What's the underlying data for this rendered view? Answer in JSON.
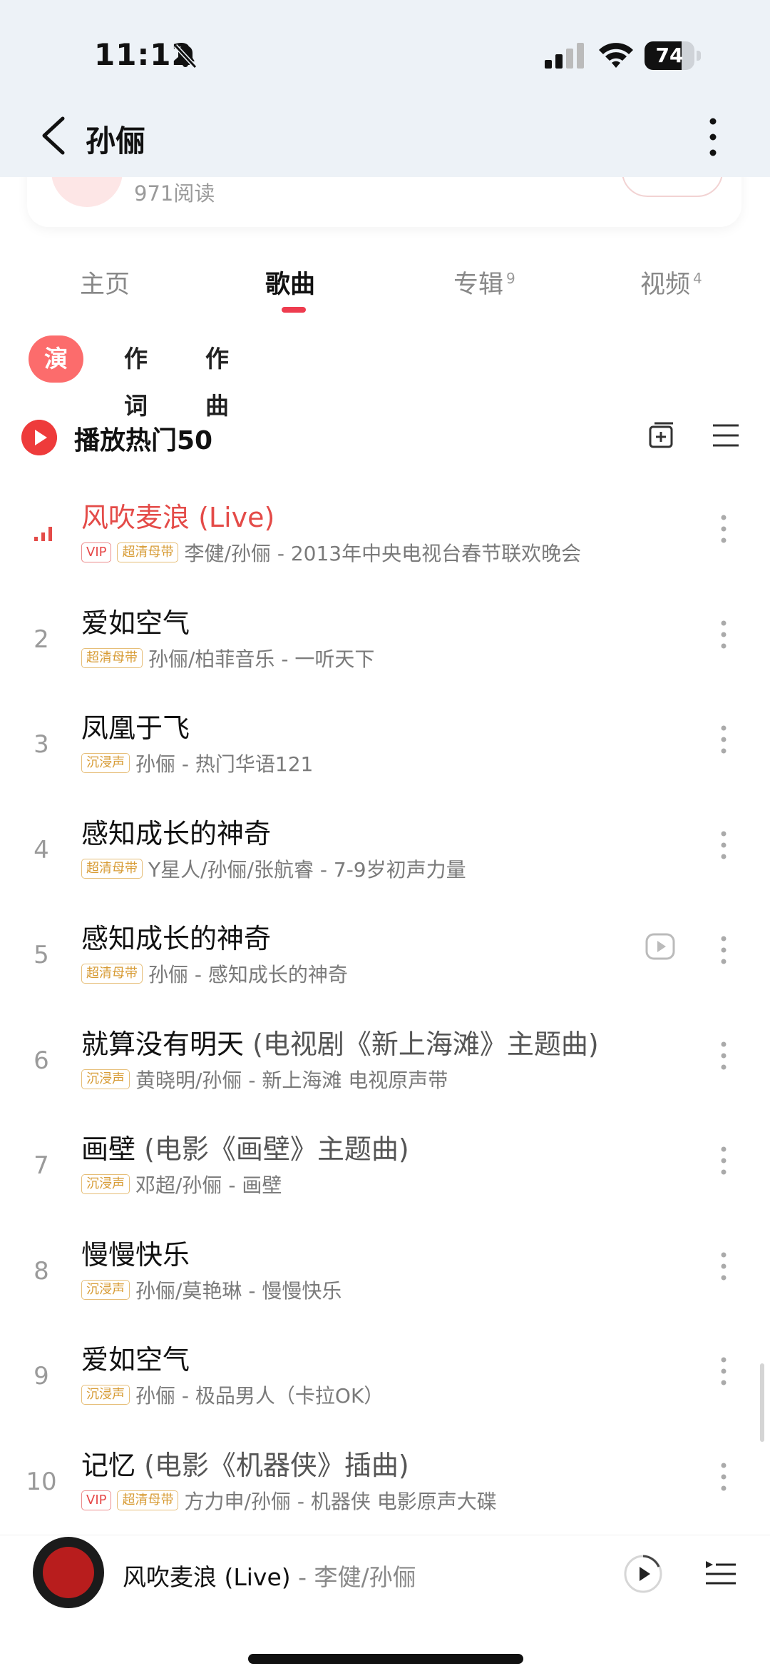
{
  "status_bar": {
    "time": "11:12",
    "battery": "74",
    "battery_level": 0.74
  },
  "header": {
    "title": "孙俪"
  },
  "profile_card": {
    "reads": "971阅读"
  },
  "tabs": [
    {
      "label": "主页",
      "count": ""
    },
    {
      "label": "歌曲",
      "count": ""
    },
    {
      "label": "专辑",
      "count": "9"
    },
    {
      "label": "视频",
      "count": "4"
    }
  ],
  "filters": [
    "演唱",
    "作词",
    "作曲"
  ],
  "play_all": {
    "label": "播放热门50"
  },
  "songs": [
    {
      "index": "",
      "title": "风吹麦浪",
      "suffix": " (Live)",
      "badges": [
        "VIP",
        "超清母带"
      ],
      "meta": "李健/孙俪 - 2013年中央电视台春节联欢晚会"
    },
    {
      "index": "2",
      "title": "爱如空气",
      "suffix": "",
      "badges": [
        "超清母带"
      ],
      "meta": "孙俪/柏菲音乐 - 一听天下"
    },
    {
      "index": "3",
      "title": "凤凰于飞",
      "suffix": "",
      "badges": [
        "沉浸声"
      ],
      "meta": "孙俪 - 热门华语121"
    },
    {
      "index": "4",
      "title": "感知成长的神奇",
      "suffix": "",
      "badges": [
        "超清母带"
      ],
      "meta": "Y星人/孙俪/张航睿 - 7-9岁初声力量"
    },
    {
      "index": "5",
      "title": "感知成长的神奇",
      "suffix": "",
      "badges": [
        "超清母带"
      ],
      "meta": "孙俪 - 感知成长的神奇"
    },
    {
      "index": "6",
      "title": "就算没有明天",
      "suffix": " (电视剧《新上海滩》主题曲)",
      "badges": [
        "沉浸声"
      ],
      "meta": "黄晓明/孙俪 - 新上海滩 电视原声带"
    },
    {
      "index": "7",
      "title": "画壁",
      "suffix": " (电影《画壁》主题曲)",
      "badges": [
        "沉浸声"
      ],
      "meta": "邓超/孙俪 - 画壁"
    },
    {
      "index": "8",
      "title": "慢慢快乐",
      "suffix": "",
      "badges": [
        "沉浸声"
      ],
      "meta": "孙俪/莫艳琳 - 慢慢快乐"
    },
    {
      "index": "9",
      "title": "爱如空气",
      "suffix": "",
      "badges": [
        "沉浸声"
      ],
      "meta": "孙俪 - 极品男人（卡拉OK）"
    },
    {
      "index": "10",
      "title": "记忆",
      "suffix": " (电影《机器侠》插曲)",
      "badges": [
        "VIP",
        "超清母带"
      ],
      "meta": "方力申/孙俪 - 机器侠 电影原声大碟"
    }
  ],
  "now_playing": {
    "title": "风吹麦浪 (Live)",
    "artist": " - 李健/孙俪"
  },
  "colors": {
    "accent": "#ee3c4f",
    "playing": "#e44b48",
    "chip": "#fc6c6c"
  }
}
